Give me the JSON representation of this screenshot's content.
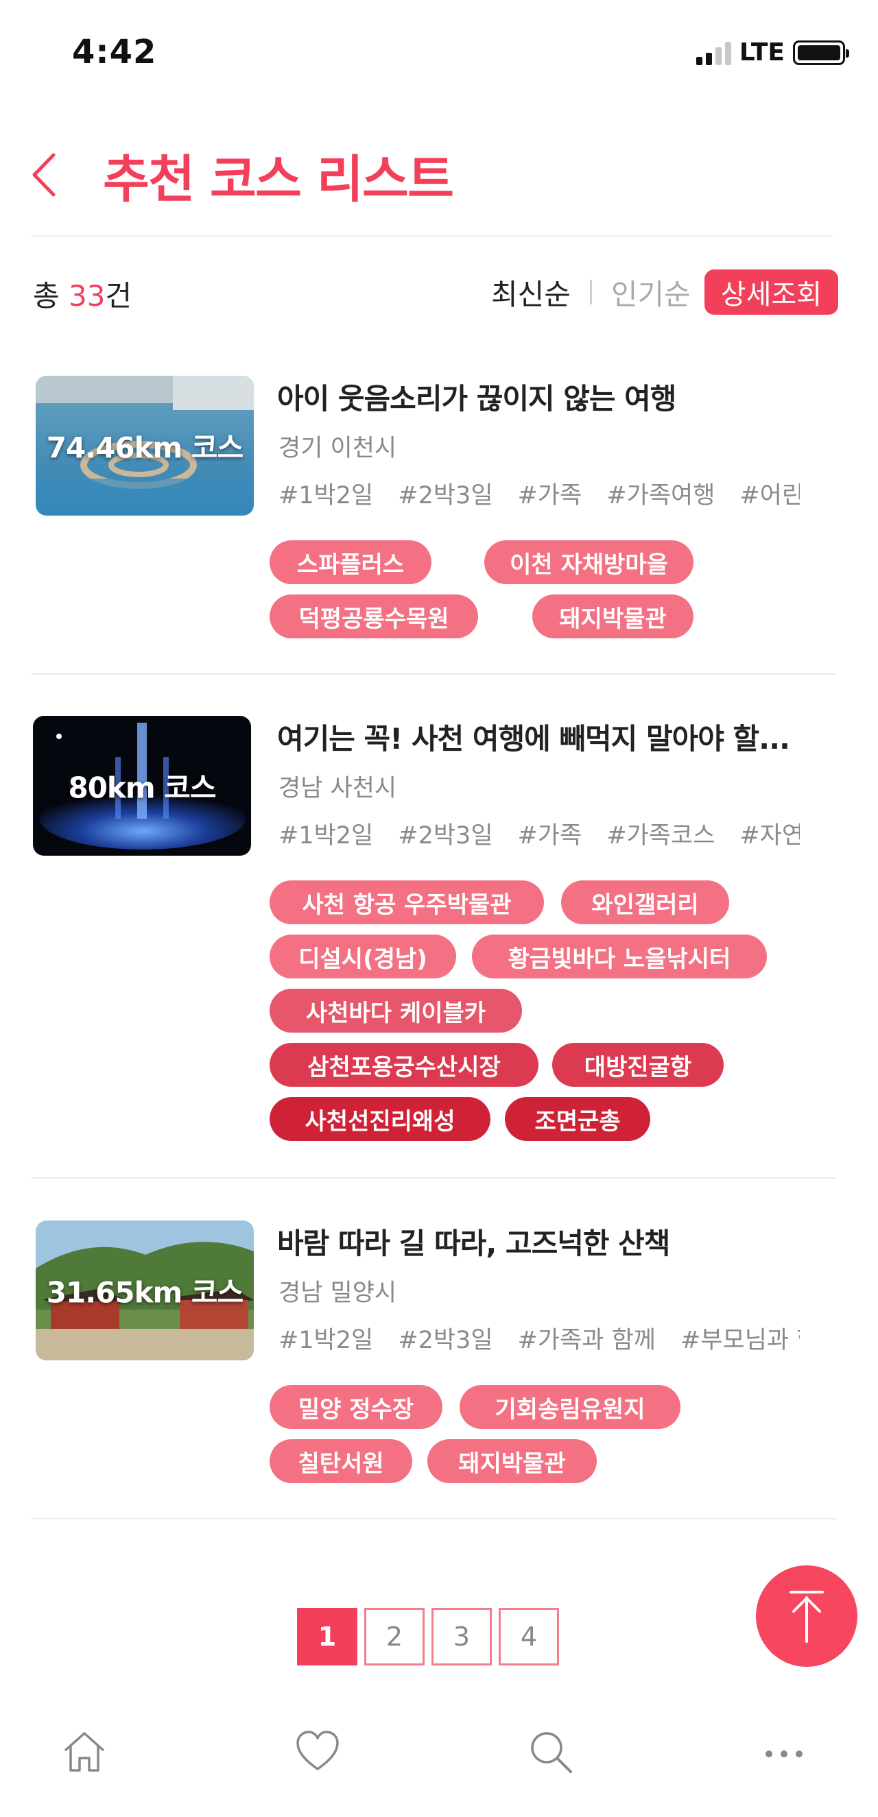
{
  "status_bar": {
    "time": "4:42",
    "network": "LTE"
  },
  "header": {
    "title": "추천 코스 리스트"
  },
  "summary": {
    "prefix": "총 ",
    "count": "33",
    "suffix": "건"
  },
  "sort": {
    "latest": "최신순",
    "popular": "인기순",
    "detail": "상세조회"
  },
  "colors": {
    "accent": "#f2405b",
    "chip_light": "#f47183",
    "chip_mid": "#e03a50",
    "chip_dark": "#cf2236"
  },
  "courses": [
    {
      "distance": "74.46km 코스",
      "title": "아이 웃음소리가 끊이지 않는 여행",
      "region": "경기 이천시",
      "tags": [
        "#1박2일",
        "#2박3일",
        "#가족",
        "#가족여행",
        "#어린이..."
      ],
      "places": [
        "스파플러스",
        "이천 자채방마을",
        "덕평공룡수목원",
        "돼지박물관"
      ]
    },
    {
      "distance": "80km 코스",
      "title": "여기는 꼭! 사천 여행에 빼먹지 말아야 할...",
      "region": "경남 사천시",
      "tags": [
        "#1박2일",
        "#2박3일",
        "#가족",
        "#가족코스",
        "#자연과..."
      ],
      "places": [
        "사천 항공 우주박물관",
        "와인갤러리",
        "디설시(경남)",
        "황금빛바다 노을낚시터",
        "사천바다 케이블카",
        "삼천포용궁수산시장",
        "대방진굴항",
        "사천선진리왜성",
        "조면군총"
      ]
    },
    {
      "distance": "31.65km 코스",
      "title": "바람 따라 길 따라, 고즈넉한 산책",
      "region": "경남 밀양시",
      "tags": [
        "#1박2일",
        "#2박3일",
        "#가족과 함께",
        "#부모님과 함..."
      ],
      "places": [
        "밀양 정수장",
        "기회송림유원지",
        "칠탄서원",
        "돼지박물관"
      ]
    }
  ],
  "pagination": {
    "pages": [
      "1",
      "2",
      "3",
      "4"
    ],
    "current": "1"
  },
  "bottom_nav": {
    "icons": [
      "home-icon",
      "heart-icon",
      "search-icon",
      "more-icon"
    ]
  }
}
